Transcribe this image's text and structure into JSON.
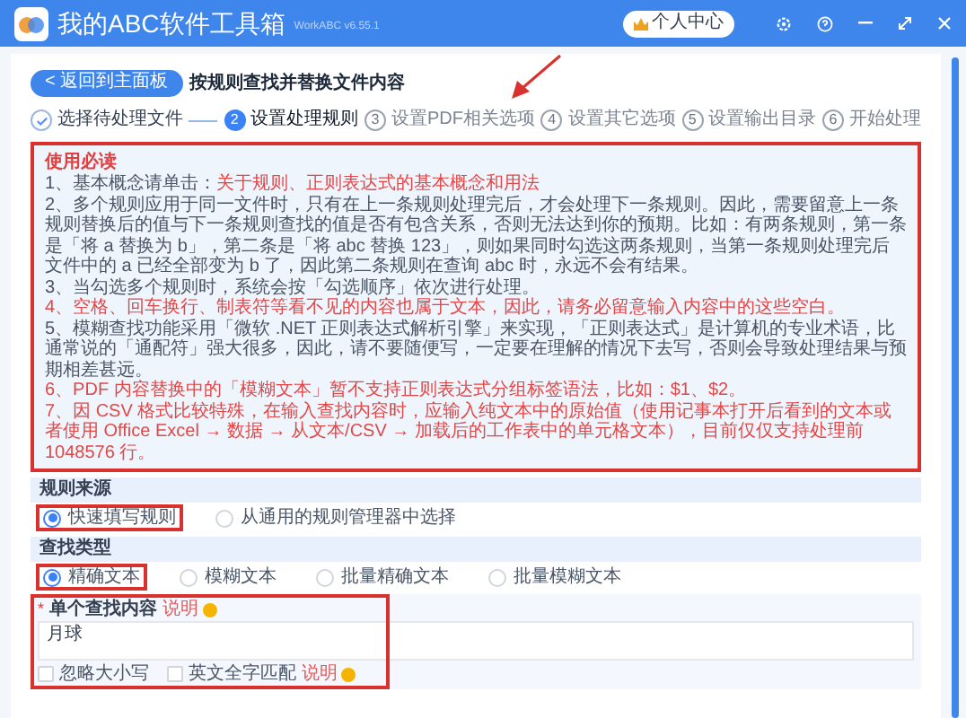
{
  "window": {
    "title": "我的ABC软件工具箱",
    "version": "WorkABC v6.55.1",
    "user_button": "个人中心"
  },
  "page": {
    "back_button": "< 返回到主面板",
    "title": "按规则查找并替换文件内容"
  },
  "steps": [
    {
      "label": "选择待处理文件",
      "done": true,
      "selected": false
    },
    {
      "number": "2",
      "label": "设置处理规则",
      "done": false,
      "selected": true
    },
    {
      "number": "3",
      "label": "设置PDF相关选项",
      "done": false,
      "selected": false
    },
    {
      "number": "4",
      "label": "设置其它选项",
      "done": false,
      "selected": false
    },
    {
      "number": "5",
      "label": "设置输出目录",
      "done": false,
      "selected": false
    },
    {
      "number": "6",
      "label": "开始处理",
      "done": false,
      "selected": false
    }
  ],
  "notice": {
    "title": "使用必读",
    "annotated": true,
    "items": [
      {
        "text": "1、基本概念请单击：",
        "link": "关于规则、正则表达式的基本概念和用法",
        "emphasis": false
      },
      {
        "text": "2、多个规则应用于同一文件时，只有在上一条规则处理完后，才会处理下一条规则。因此，需要留意上一条规则替换后的值与下一条规则查找的值是否有包含关系，否则无法达到你的预期。比如：有两条规则，第一条是「将 a 替换为 b」，第二条是「将 abc 替换 123」，则如果同时勾选这两条规则，当第一条规则处理完后文件中的 a 已经全部变为 b 了，因此第二条规则在查询 abc 时，永远不会有结果。",
        "emphasis": false
      },
      {
        "text": "3、当勾选多个规则时，系统会按「勾选顺序」依次进行处理。",
        "emphasis": false
      },
      {
        "text": "4、空格、回车换行、制表符等看不见的内容也属于文本，因此，请务必留意输入内容中的这些空白。",
        "emphasis": true
      },
      {
        "text": "5、模糊查找功能采用「微软 .NET 正则表达式解析引擎」来实现，「正则表达式」是计算机的专业术语，比通常说的「通配符」强大很多，因此，请不要随便写，一定要在理解的情况下去写，否则会导致处理结果与预期相差甚远。",
        "emphasis": false
      },
      {
        "text": "6、PDF 内容替换中的「模糊文本」暂不支持正则表达式分组标签语法，比如：$1、$2。",
        "emphasis": true
      },
      {
        "text": "7、因 CSV 格式比较特殊，在输入查找内容时，应输入纯文本中的原始值（使用记事本打开后看到的文本或者使用 Office Excel → 数据 → 从文本/CSV → 加载后的工作表中的单元格文本），目前仅仅支持处理前 1048576 行。",
        "emphasis": true
      }
    ]
  },
  "rule_source": {
    "title": "规则来源",
    "options": [
      {
        "label": "快速填写规则",
        "selected": true,
        "annotated": true
      },
      {
        "label": "从通用的规则管理器中选择",
        "selected": false,
        "annotated": false
      }
    ]
  },
  "find_type": {
    "title": "查找类型",
    "options": [
      {
        "label": "精确文本",
        "selected": true,
        "annotated": true
      },
      {
        "label": "模糊文本",
        "selected": false,
        "annotated": false
      },
      {
        "label": "批量精确文本",
        "selected": false,
        "annotated": false
      },
      {
        "label": "批量模糊文本",
        "selected": false,
        "annotated": false
      }
    ]
  },
  "find_input": {
    "required_mark": "*",
    "label": "单个查找内容",
    "help": "说明",
    "value": "月球",
    "annotated": true
  },
  "checkboxes": [
    {
      "label": "忽略大小写",
      "checked": false
    },
    {
      "label": "英文全字匹配",
      "checked": false,
      "help": "说明"
    }
  ]
}
